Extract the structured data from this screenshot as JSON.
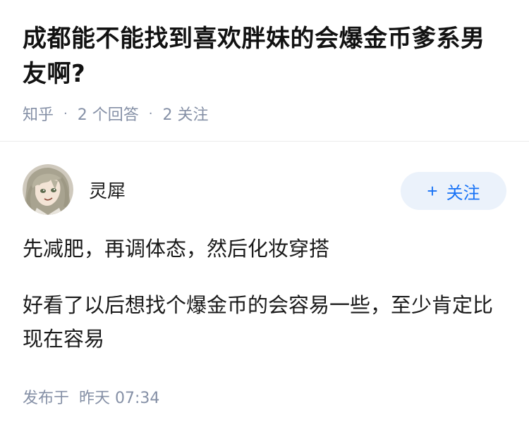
{
  "question": {
    "title": "成都能不能找到喜欢胖妹的会爆金币爹系男友啊?",
    "source": "知乎",
    "separator": "·",
    "answers_count": "2 个回答",
    "followers_count": "2 关注"
  },
  "answer": {
    "author_name": "灵犀",
    "follow_button": {
      "icon": "plus-icon",
      "plus_glyph": "+",
      "label": "关注",
      "color": "#1772f6",
      "background": "#ebf2fb"
    },
    "paragraphs": [
      "先减肥，再调体态，然后化妆穿搭",
      "好看了以后想找个爆金币的会容易一些，至少肯定比现在容易"
    ],
    "published_label": "发布于",
    "published_time": "昨天 07:34"
  },
  "colors": {
    "text": "#1a1a1a",
    "meta": "#8590a6",
    "accent": "#1772f6",
    "divider": "#ebebeb"
  }
}
